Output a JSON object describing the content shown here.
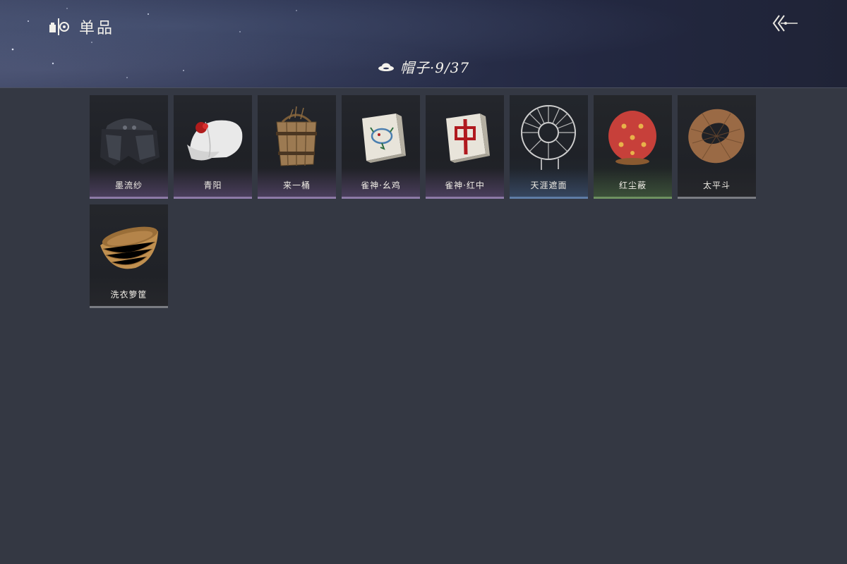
{
  "header": {
    "title": "单品",
    "app_icon": "collection-icon",
    "back_icon": "back-arrow-icon"
  },
  "category": {
    "icon": "hat-icon",
    "label": "帽子·9/37"
  },
  "items": [
    {
      "name": "墨流纱",
      "rarity": "purple",
      "icon": "black-veil-hat-icon"
    },
    {
      "name": "青阳",
      "rarity": "purple",
      "icon": "white-cap-icon"
    },
    {
      "name": "来一桶",
      "rarity": "purple",
      "icon": "wooden-bucket-icon"
    },
    {
      "name": "雀神·幺鸡",
      "rarity": "purple",
      "icon": "mahjong-bird-tile-icon"
    },
    {
      "name": "雀神·红中",
      "rarity": "purple",
      "icon": "mahjong-red-dragon-tile-icon"
    },
    {
      "name": "天涯遮面",
      "rarity": "blue",
      "icon": "wire-frame-hat-icon"
    },
    {
      "name": "红尘蔽",
      "rarity": "green",
      "icon": "red-lantern-hat-icon"
    },
    {
      "name": "太平斗",
      "rarity": "gray",
      "icon": "woven-ring-hat-icon"
    },
    {
      "name": "洗衣箩筐",
      "rarity": "gray",
      "icon": "laundry-basket-icon"
    }
  ],
  "colors": {
    "background": "#343843",
    "purple_rarity": "#8d7aa6",
    "blue_rarity": "#5f7da6",
    "green_rarity": "#6e9160",
    "gray_rarity": "#7a7c82"
  }
}
